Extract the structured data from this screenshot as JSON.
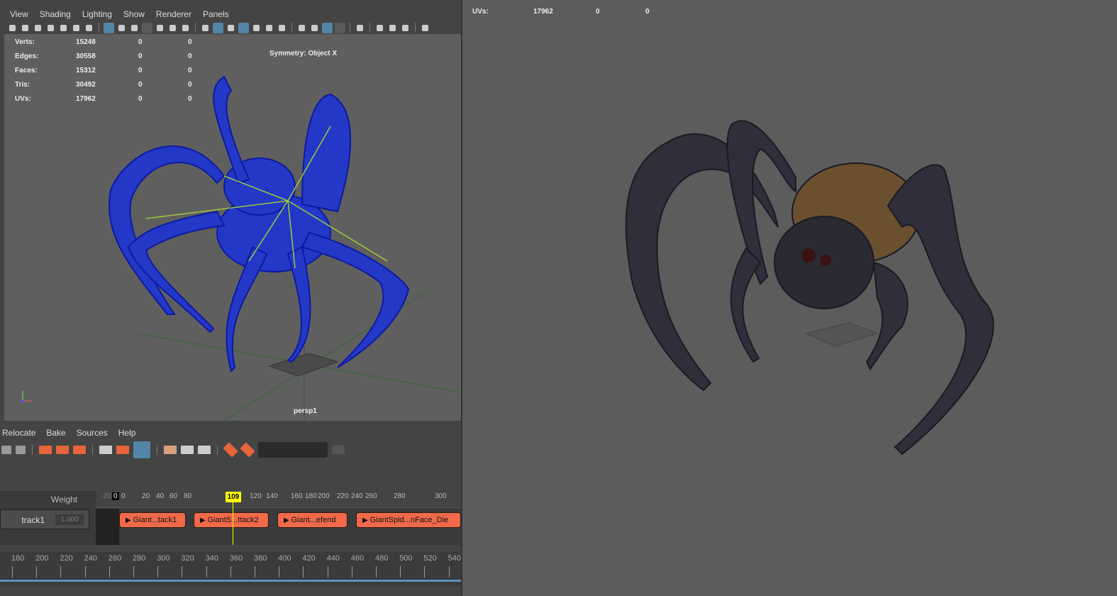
{
  "viewport_menu": [
    "View",
    "Shading",
    "Lighting",
    "Show",
    "Renderer",
    "Panels"
  ],
  "hud": {
    "rows": [
      {
        "label": "Verts:",
        "a": "15248",
        "b": "0",
        "c": "0"
      },
      {
        "label": "Edges:",
        "a": "30558",
        "b": "0",
        "c": "0"
      },
      {
        "label": "Faces:",
        "a": "15312",
        "b": "0",
        "c": "0"
      },
      {
        "label": "Tris:",
        "a": "30492",
        "b": "0",
        "c": "0"
      },
      {
        "label": "UVs:",
        "a": "17962",
        "b": "0",
        "c": "0"
      }
    ],
    "symmetry": "Symmetry: Object X",
    "camera": "persp1"
  },
  "right_hud": {
    "label": "UVs:",
    "a": "17962",
    "b": "0",
    "c": "0"
  },
  "trax_menu": [
    "Relocate",
    "Bake",
    "Sources",
    "Help"
  ],
  "trax": {
    "weight_header": "Weight",
    "track": "track1",
    "weight": "1.000",
    "current_frame": "109",
    "start_marker": "0",
    "ruler": [
      "-20",
      "0",
      "20",
      "40",
      "60",
      "80",
      "120",
      "140",
      "160",
      "180",
      "200",
      "220",
      "240",
      "260",
      "280",
      "300"
    ],
    "clips": [
      "Giant...tack1",
      "GiantS...ttack2",
      "Giant...efend",
      "GiantSpid...nFace_Die"
    ]
  },
  "timeline": [
    "180",
    "200",
    "220",
    "240",
    "260",
    "280",
    "300",
    "320",
    "340",
    "360",
    "380",
    "400",
    "420",
    "440",
    "460",
    "480",
    "500",
    "520",
    "540"
  ],
  "colors": {
    "clip": "#f06a4a",
    "wire": "#1a2fd0",
    "active": "#5285a6"
  }
}
